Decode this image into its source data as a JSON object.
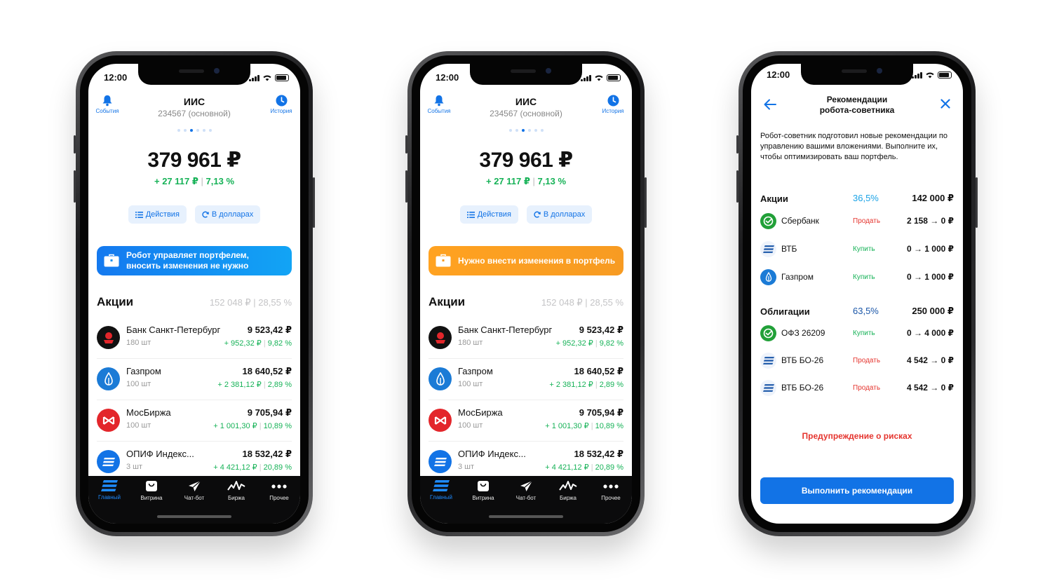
{
  "status_time": "12:00",
  "header": {
    "events_label": "События",
    "history_label": "История",
    "title": "ИИС",
    "subtitle": "234567 (основной)"
  },
  "portfolio": {
    "total": "379 961 ₽",
    "gain_abs": "+ 27 117 ₽",
    "gain_pct": "7,13 %",
    "actions_label": "Действия",
    "dollars_label": "В долларах"
  },
  "banners": {
    "robot_line1": "Робот управляет портфелем,",
    "robot_line2": "вносить изменения не нужно",
    "change": "Нужно внести изменения в портфель"
  },
  "stocks": {
    "title": "Акции",
    "total": "152 048 ₽",
    "pct": "28,55 %",
    "rows": [
      {
        "name": "Банк Санкт-Петербург",
        "qty": "180 шт",
        "price": "9 523,42 ₽",
        "chg": "+ 952,32 ₽",
        "chg_pct": "9,82 %"
      },
      {
        "name": "Газпром",
        "qty": "100 шт",
        "price": "18 640,52 ₽",
        "chg": "+ 2 381,12 ₽",
        "chg_pct": "2,89 %"
      },
      {
        "name": "МосБиржа",
        "qty": "100 шт",
        "price": "9 705,94 ₽",
        "chg": "+ 1 001,30 ₽",
        "chg_pct": "10,89 %"
      },
      {
        "name": "ОПИФ Индекс...",
        "qty": "3 шт",
        "price": "18 532,42 ₽",
        "chg": "+ 4 421,12 ₽",
        "chg_pct": "20,89 %"
      }
    ]
  },
  "tabs": [
    "Главный",
    "Витрина",
    "Чат-бот",
    "Биржа",
    "Прочее"
  ],
  "reco": {
    "title_line1": "Рекомендации",
    "title_line2": "робота-советника",
    "intro": "Робот-советник подготовил новые рекомендации по управлению вашими вложениями. Выполните их, чтобы оптимизировать ваш портфель.",
    "stocks": {
      "name": "Акции",
      "pct": "36,5%",
      "sum": "142 000 ₽"
    },
    "stock_rows": [
      {
        "name": "Сбербанк",
        "action": "Продать",
        "change": "2 158 → 0 ₽"
      },
      {
        "name": "ВТБ",
        "action": "Купить",
        "change": "0 → 1 000 ₽"
      },
      {
        "name": "Газпром",
        "action": "Купить",
        "change": "0 → 1 000 ₽"
      }
    ],
    "bonds": {
      "name": "Облигации",
      "pct": "63,5%",
      "sum": "250 000 ₽"
    },
    "bond_rows": [
      {
        "name": "ОФЗ 26209",
        "action": "Купить",
        "change": "0 → 4 000 ₽"
      },
      {
        "name": "ВТБ БО-26",
        "action": "Продать",
        "change": "4 542 → 0 ₽"
      },
      {
        "name": "ВТБ БО-26",
        "action": "Продать",
        "change": "4 542 → 0 ₽"
      }
    ],
    "risk": "Предупреждение о рисках",
    "execute": "Выполнить рекомендации"
  },
  "colors": {
    "accent": "#1273e6",
    "positive": "#16b257",
    "negative": "#e5352f",
    "banner_orange": "#f79b22"
  }
}
